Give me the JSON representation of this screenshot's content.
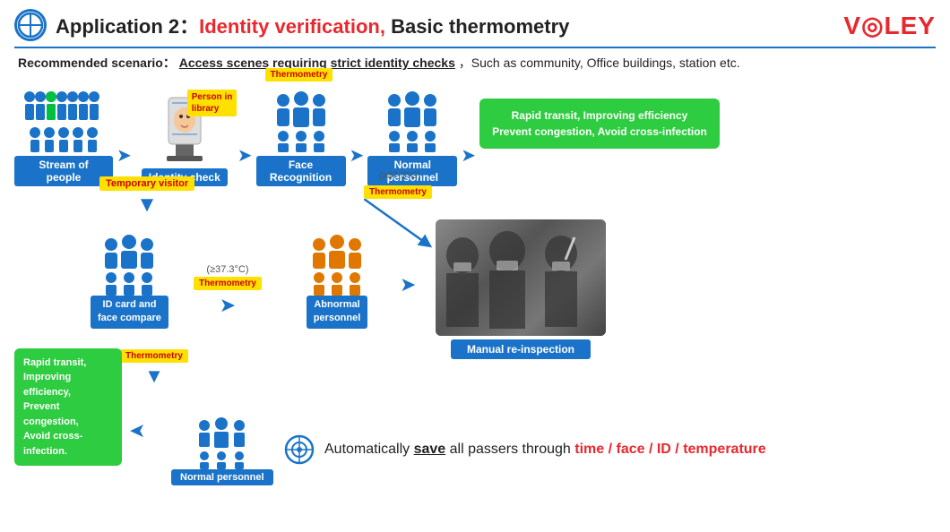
{
  "header": {
    "icon": "⊕",
    "title_prefix": "Application 2：",
    "title_highlight": "Identity verification,",
    "title_suffix": " Basic thermometry",
    "logo": "VØLEY"
  },
  "scenario": {
    "label": "Recommended scenario：",
    "highlight": "Access scenes requiring strict identity checks",
    "suffix": "，Such as community, Office buildings, station etc."
  },
  "top_flow": {
    "items": [
      {
        "label": "Stream of people"
      },
      {
        "label": "Identity check"
      },
      {
        "label": "Face Recognition"
      },
      {
        "label": "Normal personnel"
      }
    ],
    "badges": {
      "person_in_library": "Person in\nlibrary",
      "thermometry_top": "Thermometry"
    },
    "green_box": "Rapid transit, Improving efficiency\nPrevent congestion, Avoid cross-infection"
  },
  "middle_flow": {
    "temp_label_top": "(≥37.3°C)",
    "thermometry_badge": "Thermometry",
    "temp_label_mid": "(≥37.3°C)",
    "thermometry_mid": "Thermometry",
    "visitor_badge": "Temporary visitor",
    "id_label": "ID card and\nface compare",
    "abnormal_label": "Abnormal\npersonnel",
    "manual_label": "Manual re-inspection"
  },
  "bottom_flow": {
    "thermometry_badge": "Thermometry",
    "normal_label": "Normal personnel",
    "green_box": "Rapid transit,\nImproving efficiency,\nPrevent congestion,\nAvoid cross-infection."
  },
  "footer": {
    "text_prefix": "Automatically ",
    "save_word": "save",
    "text_mid": " all passers through ",
    "highlights": "time / face / ID / temperature"
  }
}
